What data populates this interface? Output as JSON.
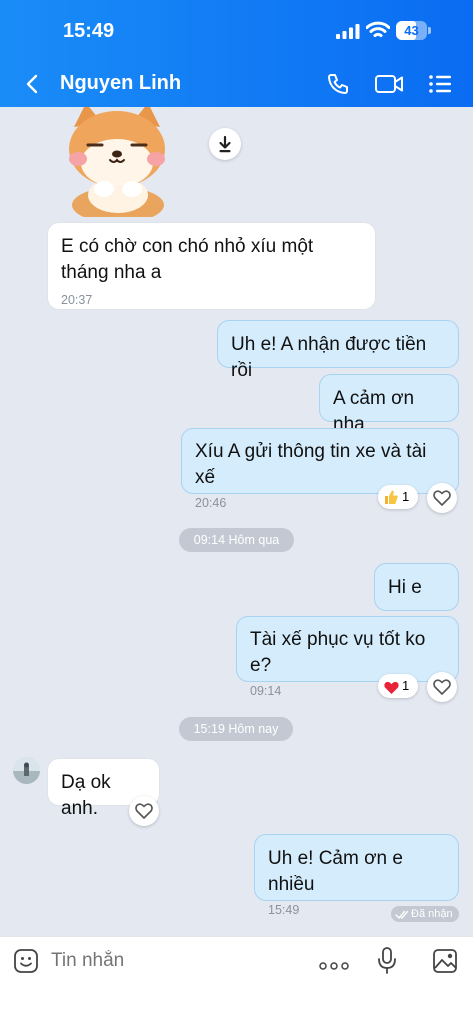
{
  "status": {
    "time": "15:49",
    "battery": "43"
  },
  "header": {
    "contact_name": "Nguyen Linh"
  },
  "messages": [
    {
      "text": "E có chờ con chó nhỏ xíu một tháng nha a",
      "time": "20:37"
    },
    {
      "text": "Uh e! A nhận được tiền rồi"
    },
    {
      "text": "A cảm ơn nha"
    },
    {
      "text": "Xíu A gửi thông tin xe và tài xế",
      "time": "20:46",
      "reaction_count": "1"
    },
    {
      "text": "Hi e"
    },
    {
      "text": "Tài xế phục vụ tốt ko e?",
      "time": "09:14",
      "reaction_count": "1"
    },
    {
      "text": "Dạ ok anh."
    },
    {
      "text": "Uh e! Cảm ơn e nhiều",
      "time": "15:49"
    }
  ],
  "separators": [
    "09:14 Hôm qua",
    "15:19 Hôm nay"
  ],
  "read_status": "Đã nhận",
  "input": {
    "placeholder": "Tin nhắn"
  },
  "colors": {
    "header": "#0a6cf2",
    "outgoing_bubble": "#d4ecfb",
    "incoming_bubble": "#ffffff",
    "background": "#e4e8f1"
  }
}
